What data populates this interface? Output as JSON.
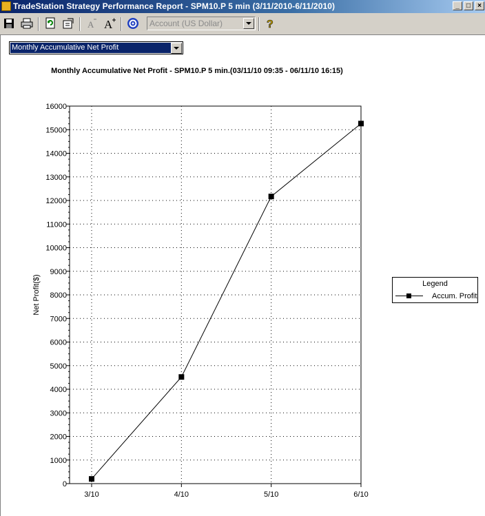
{
  "window": {
    "title": "TradeStation Strategy Performance Report - SPM10.P 5 min (3/11/2010-6/11/2010)",
    "min_label": "_",
    "max_label": "□",
    "close_label": "×"
  },
  "toolbar": {
    "account_value": "Account (US Dollar)",
    "help_glyph": "?"
  },
  "report_selector": {
    "value": "Monthly Accumulative Net Profit"
  },
  "chart_title": "Monthly Accumulative Net Profit - SPM10.P 5 min.(03/11/10 09:35 - 06/11/10 16:15)",
  "legend": {
    "title": "Legend",
    "entry": "Accum. Profit"
  },
  "chart_data": {
    "type": "line",
    "categories": [
      "3/10",
      "4/10",
      "5/10",
      "6/10"
    ],
    "series": [
      {
        "name": "Accum. Profit",
        "values": [
          200,
          4520,
          12170,
          15260
        ]
      }
    ],
    "ylabel": "Net Profit($)",
    "ylim": [
      0,
      16000
    ],
    "yticks": [
      0,
      1000,
      2000,
      3000,
      4000,
      5000,
      6000,
      7000,
      8000,
      9000,
      10000,
      11000,
      12000,
      13000,
      14000,
      15000,
      16000
    ],
    "grid": true,
    "legend_position": "right",
    "line_color": "#000000",
    "marker": "square"
  }
}
